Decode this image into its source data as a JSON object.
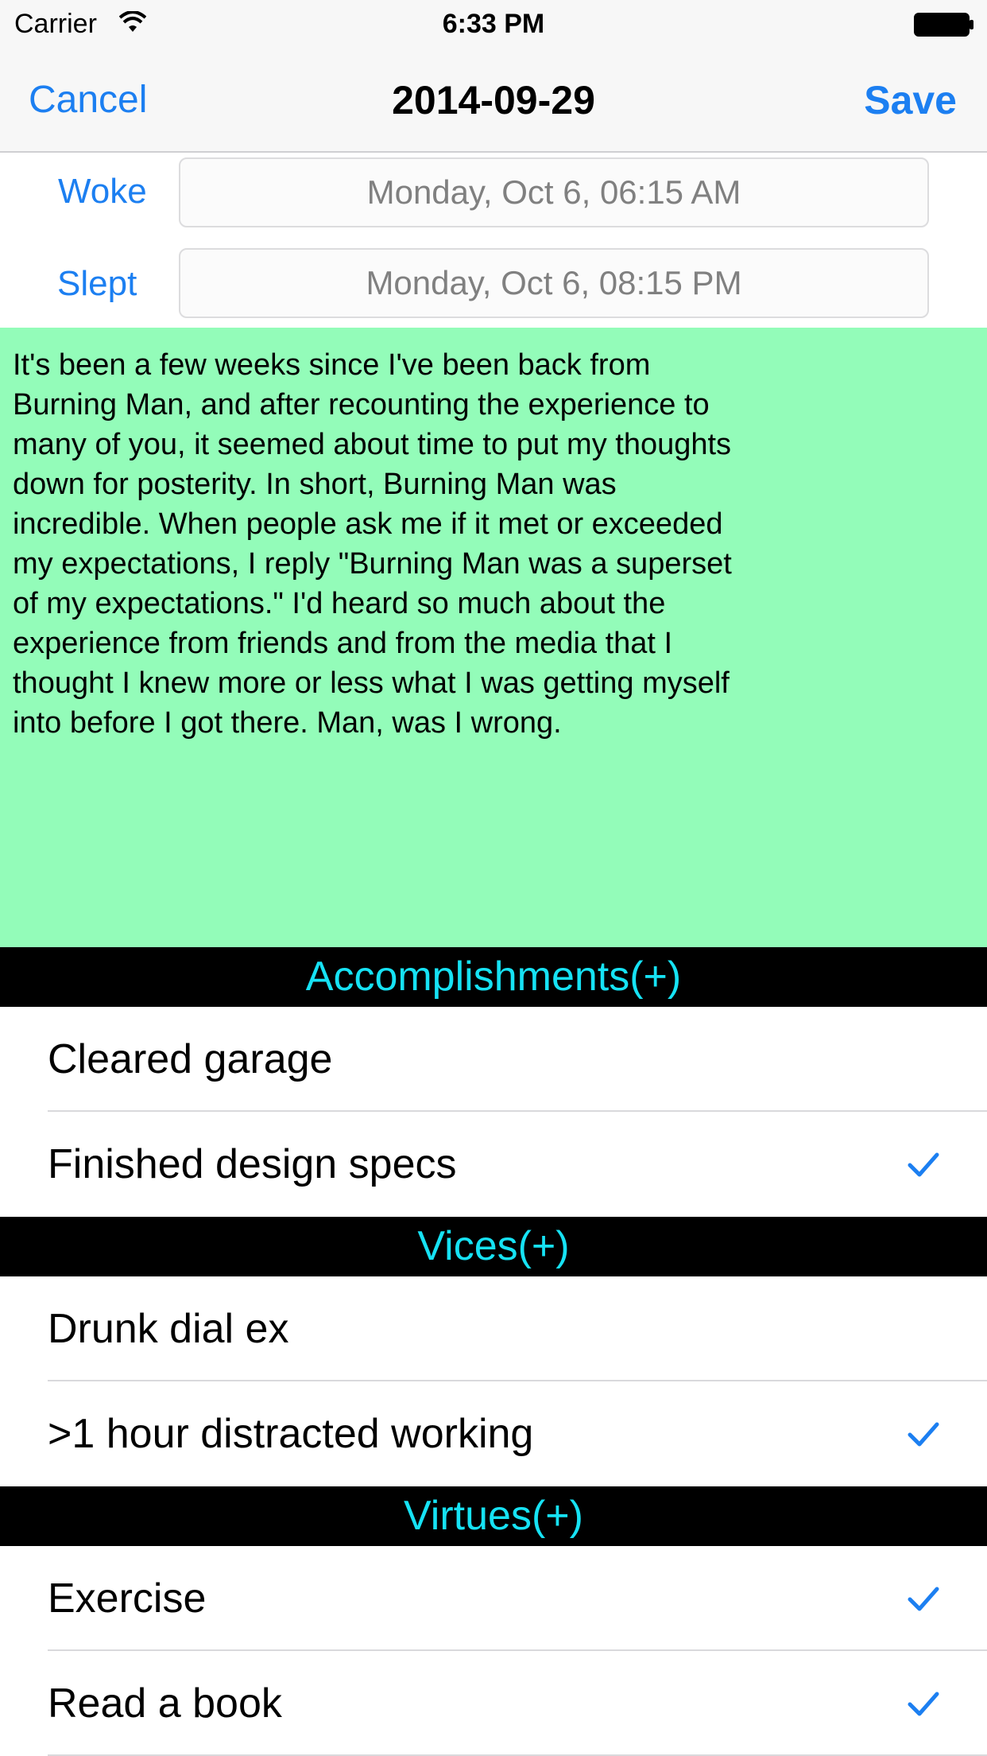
{
  "status_bar": {
    "carrier": "Carrier",
    "time": "6:33 PM"
  },
  "nav": {
    "cancel_label": "Cancel",
    "title": "2014-09-29",
    "save_label": "Save"
  },
  "times": {
    "woke_label": "Woke",
    "woke_value": "Monday, Oct 6, 06:15 AM",
    "slept_label": "Slept",
    "slept_value": "Monday, Oct 6, 08:15 PM"
  },
  "journal": {
    "text": "It's been a few weeks since I've been back from Burning Man, and after recounting the experience to many of you, it seemed about time to put my thoughts down for posterity. In short, Burning Man was incredible. When people ask me if it met or exceeded my expectations, I reply \"Burning Man was a superset of my expectations.\" I'd heard so much about the experience from friends and from the media that I thought I knew more or less what I was getting myself into before I got there. Man, was I wrong.",
    "background": "#93fcb9"
  },
  "colors": {
    "accent": "#1c7ff1",
    "section_header_text": "#16e2f4",
    "section_header_bg": "#000000"
  },
  "sections": [
    {
      "header": "Accomplishments(+)",
      "items": [
        {
          "label": "Cleared garage",
          "checked": false
        },
        {
          "label": "Finished design specs",
          "checked": true
        }
      ]
    },
    {
      "header": "Vices(+)",
      "items": [
        {
          "label": "Drunk dial ex",
          "checked": false
        },
        {
          "label": ">1 hour distracted working",
          "checked": true
        }
      ]
    },
    {
      "header": "Virtues(+)",
      "items": [
        {
          "label": "Exercise",
          "checked": true
        },
        {
          "label": "Read a book",
          "checked": true
        }
      ]
    }
  ]
}
